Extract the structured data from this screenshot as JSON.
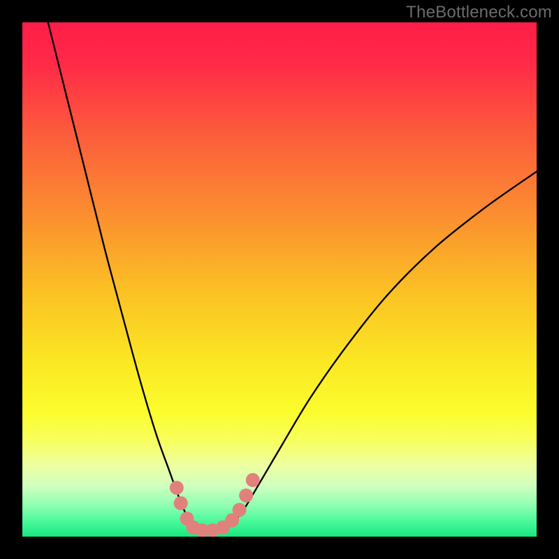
{
  "watermark": "TheBottleneck.com",
  "chart_data": {
    "type": "line",
    "title": "",
    "xlabel": "",
    "ylabel": "",
    "xlim": [
      0,
      100
    ],
    "ylim": [
      0,
      100
    ],
    "background_gradient": {
      "stops": [
        {
          "offset": 0.0,
          "color": "#ff1d49"
        },
        {
          "offset": 0.08,
          "color": "#ff2a47"
        },
        {
          "offset": 0.22,
          "color": "#fc5d3b"
        },
        {
          "offset": 0.38,
          "color": "#fb902f"
        },
        {
          "offset": 0.52,
          "color": "#fbc024"
        },
        {
          "offset": 0.66,
          "color": "#fbe723"
        },
        {
          "offset": 0.76,
          "color": "#fbfd2e"
        },
        {
          "offset": 0.81,
          "color": "#f8ff5a"
        },
        {
          "offset": 0.86,
          "color": "#edffa0"
        },
        {
          "offset": 0.9,
          "color": "#d2ffbf"
        },
        {
          "offset": 0.94,
          "color": "#8dffb1"
        },
        {
          "offset": 0.97,
          "color": "#4bf99c"
        },
        {
          "offset": 1.0,
          "color": "#17e77e"
        }
      ]
    },
    "series": [
      {
        "name": "bottleneck-curve",
        "color": "#000000",
        "width": 2.4,
        "x": [
          5.0,
          8.0,
          12.0,
          16.0,
          20.0,
          23.0,
          26.0,
          28.5,
          30.5,
          32.0,
          33.5,
          35.0,
          37.5,
          40.0,
          42.5,
          45.0,
          50.0,
          56.0,
          63.0,
          71.0,
          80.0,
          90.0,
          100.0
        ],
        "y": [
          100.0,
          88.0,
          72.0,
          56.0,
          41.0,
          30.0,
          20.0,
          13.0,
          7.5,
          4.0,
          2.0,
          1.0,
          1.0,
          2.0,
          4.5,
          8.5,
          17.0,
          27.0,
          37.0,
          47.0,
          56.0,
          64.0,
          71.0
        ]
      }
    ],
    "markers": {
      "name": "highlight-dots",
      "color": "#e1817c",
      "radius": 10,
      "points": [
        {
          "x": 30.0,
          "y": 9.5
        },
        {
          "x": 30.8,
          "y": 6.5
        },
        {
          "x": 32.0,
          "y": 3.5
        },
        {
          "x": 33.2,
          "y": 1.8
        },
        {
          "x": 35.0,
          "y": 1.2
        },
        {
          "x": 37.0,
          "y": 1.2
        },
        {
          "x": 39.0,
          "y": 1.8
        },
        {
          "x": 40.8,
          "y": 3.2
        },
        {
          "x": 42.2,
          "y": 5.2
        },
        {
          "x": 43.5,
          "y": 8.0
        },
        {
          "x": 44.8,
          "y": 11.0
        }
      ]
    }
  }
}
